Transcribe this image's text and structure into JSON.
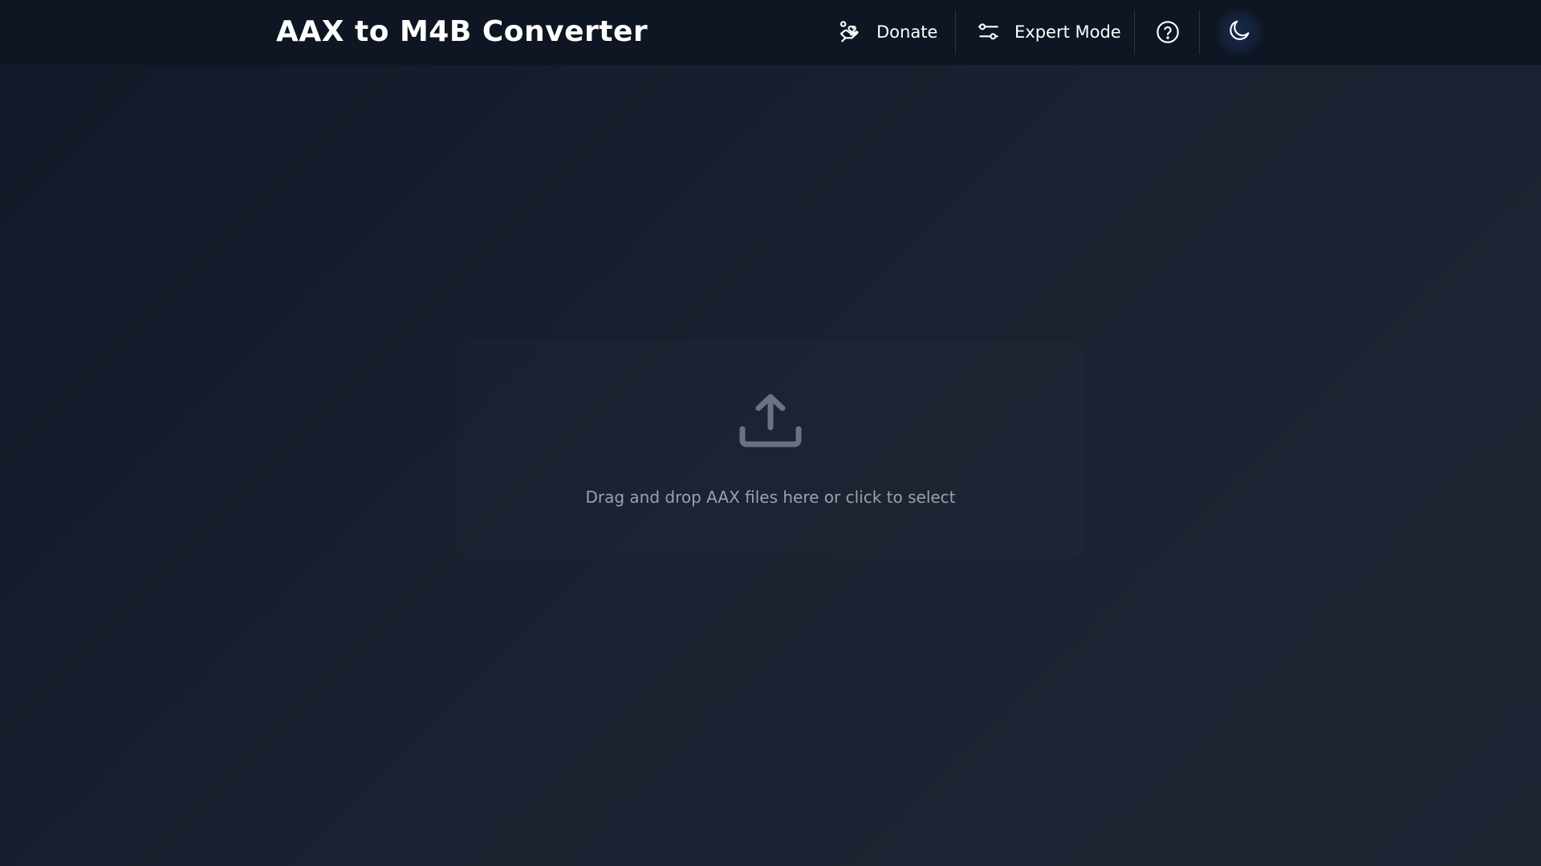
{
  "app": {
    "title": "AAX to M4B Converter"
  },
  "header": {
    "donate_label": "Donate",
    "expert_mode_label": "Expert Mode",
    "help_icon": "question-circle-icon",
    "theme_icon": "moon-icon"
  },
  "dropzone": {
    "icon": "upload-icon",
    "text": "Drag and drop AAX files here or click to select"
  },
  "colors": {
    "background": "#111827",
    "header_background": "#0f1623",
    "text": "#ffffff",
    "muted_text": "#9aa1ad",
    "icon_muted": "#6b7280"
  }
}
